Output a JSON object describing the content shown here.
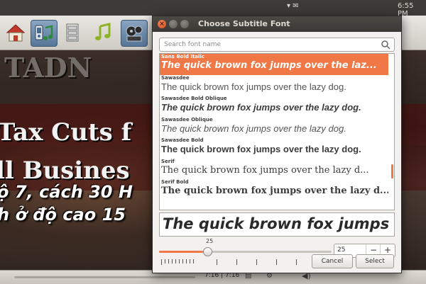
{
  "topbar": {
    "clock": "6:55 PM"
  },
  "player": {
    "toolbar": {
      "buttons": [
        {
          "name": "home",
          "icon": "home-icon"
        },
        {
          "name": "media",
          "icon": "media-player-icon"
        },
        {
          "name": "files",
          "icon": "drawer-icon"
        },
        {
          "name": "music",
          "icon": "music-note-icon"
        },
        {
          "name": "video",
          "icon": "film-reel-icon"
        }
      ]
    },
    "video": {
      "overlay_lines": [
        "TADN",
        "Tax Cuts f",
        "ll Busines"
      ],
      "subtitle_lines": [
        "ộ 7, cách 30 H",
        "h ở độ cao 15"
      ]
    },
    "status": {
      "time": "7:16 | 7:16"
    }
  },
  "dialog": {
    "title": "Choose Subtitle Font",
    "search": {
      "placeholder": "Search font name",
      "value": ""
    },
    "fonts": [
      {
        "name": "Sans Bold Italic",
        "sample": "The quick brown fox jumps over the laz...",
        "selected": true
      },
      {
        "name": "Sawasdee",
        "sample": "The quick brown fox jumps over the lazy dog.",
        "selected": false
      },
      {
        "name": "Sawasdee Bold Oblique",
        "sample": "The quick brown fox jumps over the lazy dog.",
        "selected": false
      },
      {
        "name": "Sawasdee Oblique",
        "sample": "The quick brown fox jumps over the lazy dog.",
        "selected": false
      },
      {
        "name": "Sawasdee Bold",
        "sample": "The quick brown fox jumps over the lazy dog.",
        "selected": false
      },
      {
        "name": "Serif",
        "sample": "The quick brown fox jumps over the lazy d...",
        "selected": false
      },
      {
        "name": "Serif Bold",
        "sample": "The quick brown fox jumps over the lazy d...",
        "selected": false
      }
    ],
    "preview_text": "The quick brown fox jumps over the lazy dog.",
    "size": {
      "value": 25,
      "min": 0,
      "max": 100,
      "label": "25",
      "spin_value": "25",
      "minus": "−",
      "plus": "+"
    },
    "buttons": {
      "cancel": "Cancel",
      "select": "Select"
    },
    "colors": {
      "accent": "#f07746",
      "titlebar": "#3c3b37"
    }
  }
}
